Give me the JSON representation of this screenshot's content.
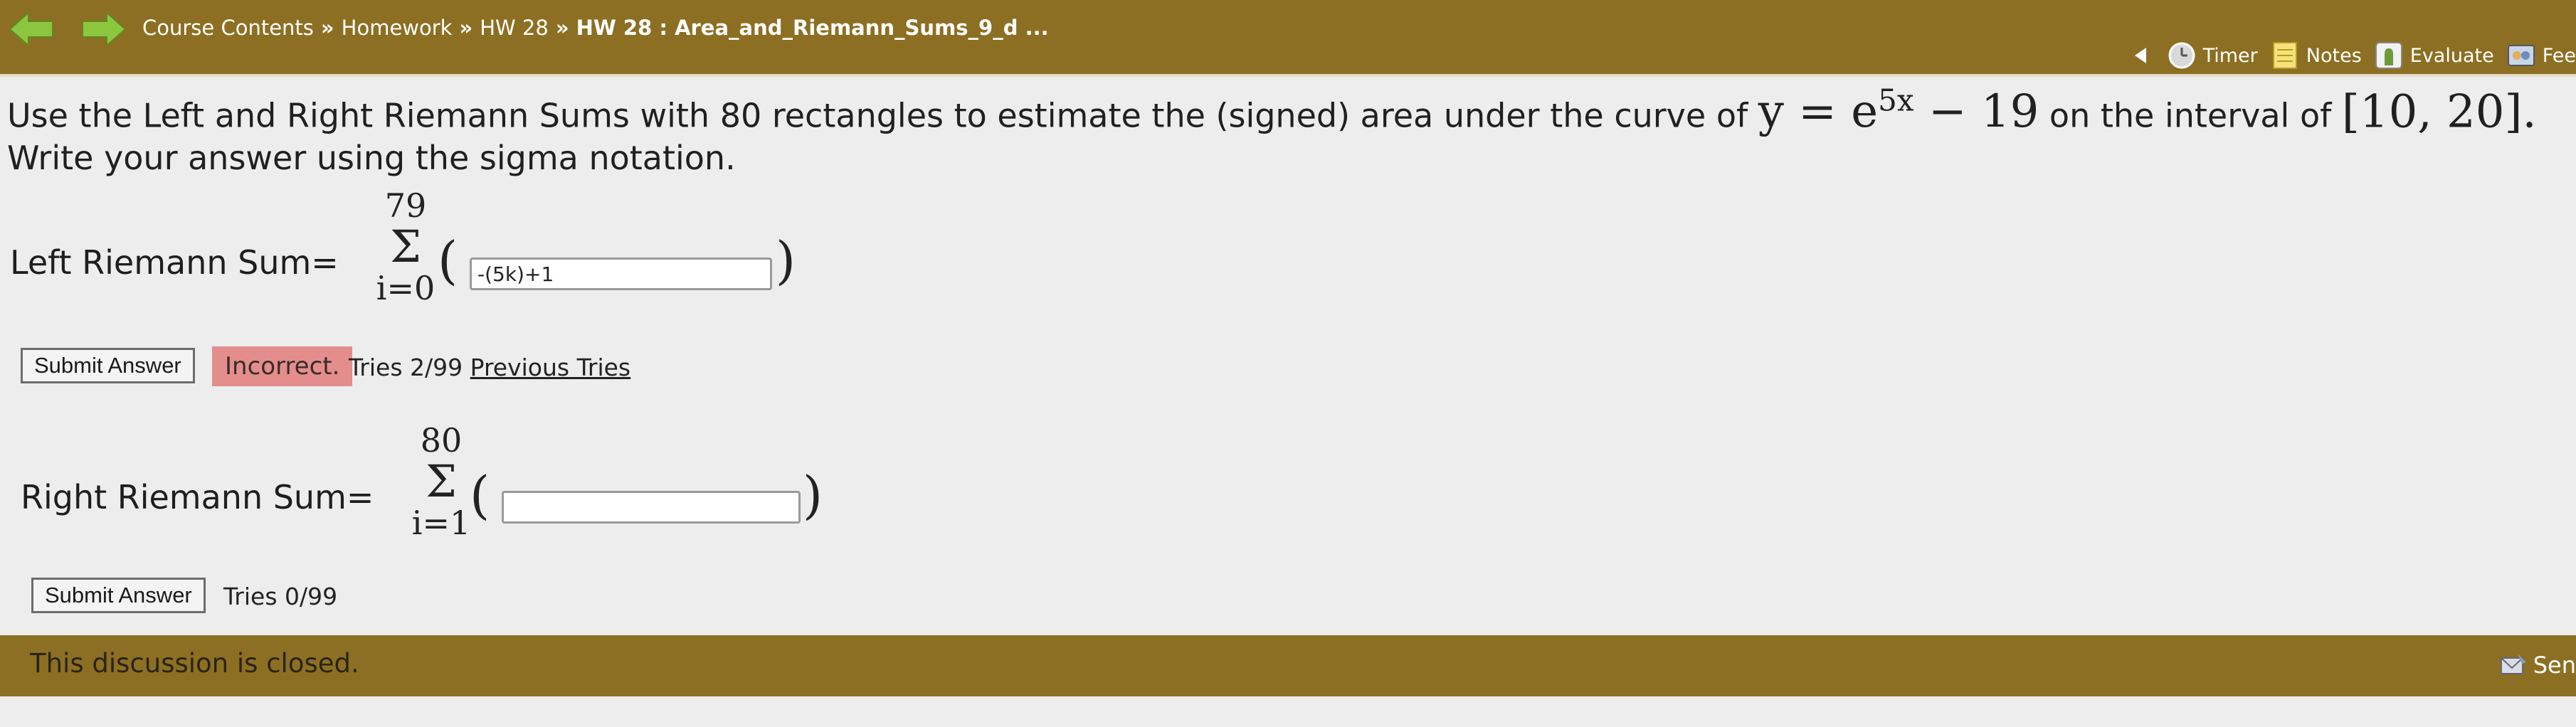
{
  "header": {
    "breadcrumb": [
      "Course Contents",
      "Homework",
      "HW 28"
    ],
    "current_page": "HW 28 : Area_and_Riemann_Sums_9_d ...",
    "separator": "»",
    "tools": {
      "timer": "Timer",
      "notes": "Notes",
      "evaluate": "Evaluate",
      "feedback": "Fee"
    }
  },
  "question": {
    "intro": "Use the Left and Right Riemann Sums with 80 rectangles to estimate the (signed) area under the curve of",
    "function_lhs": "y = e",
    "function_exp": "5x",
    "function_rest": " − 19",
    "interval_text": "on the interval of",
    "interval": "[10, 20].",
    "line2": "Write your answer using the sigma notation."
  },
  "left_sum": {
    "label": "Left Riemann Sum=",
    "upper": "79",
    "sigma": "Σ",
    "lower": "i=0",
    "open_paren": "(",
    "close_paren": ")",
    "input_value": "-(5k)+1",
    "submit_label": "Submit Answer",
    "status": "Incorrect.",
    "tries": "Tries 2/99",
    "previous_tries": "Previous Tries"
  },
  "right_sum": {
    "label": "Right Riemann Sum=",
    "upper": "80",
    "sigma": "Σ",
    "lower": "i=1",
    "open_paren": "(",
    "close_paren": ")",
    "input_value": "",
    "submit_label": "Submit Answer",
    "tries": "Tries 0/99"
  },
  "footer": {
    "text": "This discussion is closed.",
    "right_label": "Sen"
  },
  "colors": {
    "bar": "#8c6f22",
    "nav_arrow": "#8cc63f",
    "incorrect_bg": "#e48d8d",
    "page_bg": "#ededed"
  }
}
